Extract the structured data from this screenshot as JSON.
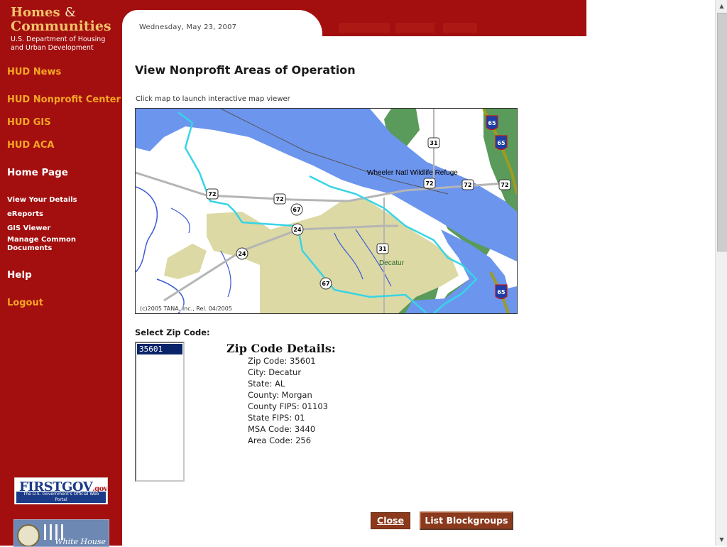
{
  "brand": {
    "line1": "Homes",
    "amp": "&",
    "line2": "Communities",
    "sub1": "U.S. Department of Housing",
    "sub2": "and Urban Development"
  },
  "nav": {
    "hud_news": "HUD News",
    "hud_nonprofit_center": "HUD Nonprofit Center",
    "hud_gis": "HUD GIS",
    "hud_aca": "HUD ACA",
    "home_page": "Home Page",
    "view_your_details": "View Your Details",
    "ereports": "eReports",
    "gis_viewer": "GIS Viewer",
    "manage_common_documents": "Manage Common Documents",
    "help": "Help",
    "logout": "Logout"
  },
  "badges": {
    "firstgov": "FIRSTGOV",
    "firstgov_suffix": ".gov",
    "firstgov_tagline": "The U.S. Government's Official Web Portal",
    "whitehouse": "White House"
  },
  "header": {
    "date": "Wednesday, May 23, 2007"
  },
  "main": {
    "title": "View Nonprofit Areas of Operation",
    "map_hint": "Click map to launch interactive map viewer"
  },
  "map": {
    "copyright": "(c)2005 TANA, Inc., Rel. 04/2005",
    "place_labels": {
      "refuge": "Wheeler Natl Wildlife Refuge",
      "city": "Decatur"
    },
    "route_shields": {
      "i65_a": "65",
      "i65_b": "65",
      "i65_c": "65",
      "us31_a": "31",
      "us31_b": "31",
      "us72_a": "72",
      "us72_b": "72",
      "us72_c": "72",
      "us72_d": "72",
      "us72_e": "72",
      "sr67_a": "67",
      "sr67_b": "67",
      "sr24_a": "24",
      "sr24_b": "24"
    },
    "colors": {
      "water": "#6c95ee",
      "urban": "#dcd9a4",
      "forest": "#5a9a5a",
      "boundary": "#37d4e6"
    }
  },
  "zip": {
    "select_label": "Select Zip Code:",
    "options": [
      "35601"
    ],
    "selected": "35601"
  },
  "details": {
    "title": "Zip Code Details:",
    "zip_code": "Zip Code: 35601",
    "city": "City: Decatur",
    "state": "State: AL",
    "county": "County: Morgan",
    "county_fips": "County FIPS: 01103",
    "state_fips": "State FIPS: 01",
    "msa_code": "MSA Code: 3440",
    "area_code": "Area Code: 256"
  },
  "buttons": {
    "close": "Close",
    "list_blockgroups": "List Blockgroups"
  },
  "scrollbar": {
    "up_icon": "arrow-up-icon",
    "down_icon": "arrow-down-icon"
  }
}
